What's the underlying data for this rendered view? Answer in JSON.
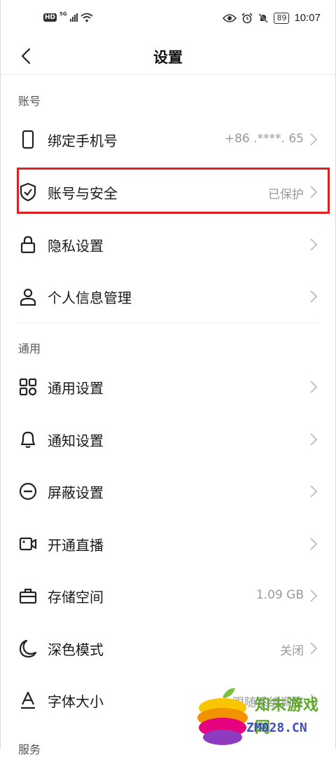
{
  "status_bar": {
    "hd": "HD",
    "signal": "5G",
    "battery": "89",
    "time": "10:07"
  },
  "header": {
    "title": "设置"
  },
  "sections": {
    "account": "账号",
    "general": "通用",
    "service": "服务"
  },
  "rows": {
    "bind_phone": {
      "label": "绑定手机号",
      "value": "+86  .****. 65"
    },
    "account_security": {
      "label": "账号与安全",
      "value": "已保护"
    },
    "privacy": {
      "label": "隐私设置",
      "value": ""
    },
    "personal_info": {
      "label": "个人信息管理",
      "value": ""
    },
    "general_settings": {
      "label": "通用设置",
      "value": ""
    },
    "notifications": {
      "label": "通知设置",
      "value": ""
    },
    "block": {
      "label": "屏蔽设置",
      "value": ""
    },
    "live": {
      "label": "开通直播",
      "value": ""
    },
    "storage": {
      "label": "存储空间",
      "value": "1.09 GB"
    },
    "dark_mode": {
      "label": "深色模式",
      "value": "关闭"
    },
    "font_size": {
      "label": "字体大小",
      "value": "跟随系统调整"
    }
  },
  "watermark": {
    "name": "知末游戏网",
    "domain": "ZM028.CN"
  },
  "colors": {
    "highlight": "#e02020",
    "text": "#1a1a1a",
    "secondary": "#999999"
  }
}
